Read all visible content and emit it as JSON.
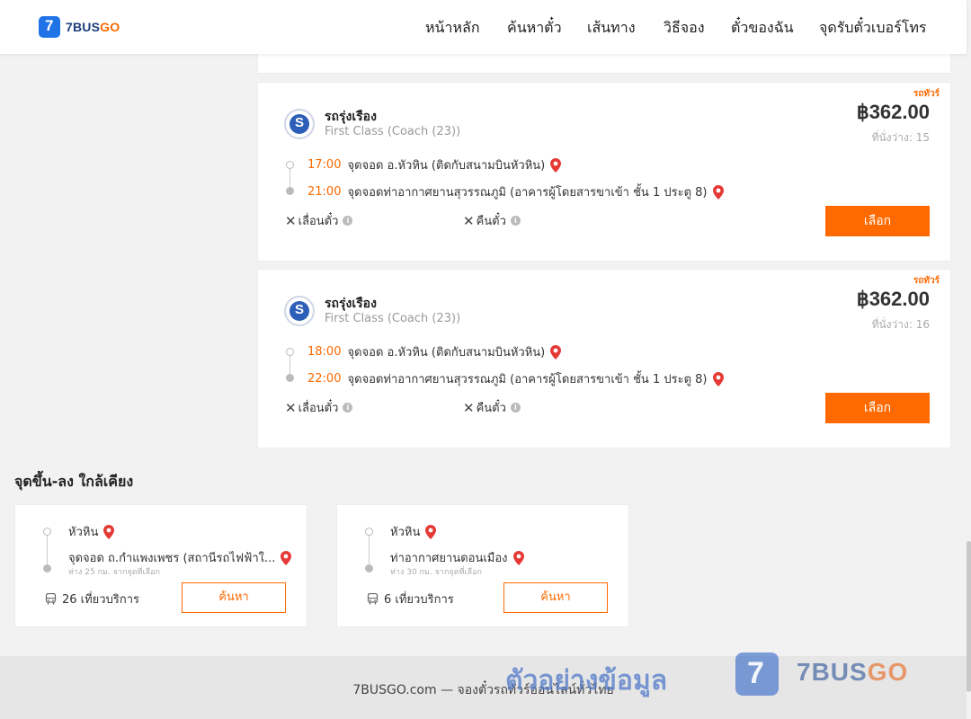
{
  "brand": {
    "logo_part1": "7BUS",
    "logo_part2": "GO"
  },
  "nav": [
    "หน้าหลัก",
    "ค้นหาตั๋ว",
    "เส้นทาง",
    "วิธีจอง",
    "ตั๋วของฉัน",
    "จุดรับตั๋วเบอร์โทร"
  ],
  "trips": [
    {
      "promo": "รถทัวร์",
      "operator": "รถรุ่งเรือง",
      "class": "First Class (Coach (23))",
      "price": "฿362.00",
      "seats": "ที่นั่งว่าง: 15",
      "depart_time": "17:00",
      "depart_stop": "จุดจอด อ.หัวหิน (ติดกับสนามบินหัวหิน)",
      "arrive_time": "21:00",
      "arrive_stop": "จุดจอดท่าอากาศยานสุวรรณภูมิ (อาคารผู้โดยสารขาเข้า ชั้น 1 ประตู 8)",
      "reschedule": "เลื่อนตั๋ว",
      "refund": "คืนตั๋ว",
      "select": "เลือก"
    },
    {
      "promo": "รถทัวร์",
      "operator": "รถรุ่งเรือง",
      "class": "First Class (Coach (23))",
      "price": "฿362.00",
      "seats": "ที่นั่งว่าง: 16",
      "depart_time": "18:00",
      "depart_stop": "จุดจอด อ.หัวหิน (ติดกับสนามบินหัวหิน)",
      "arrive_time": "22:00",
      "arrive_stop": "จุดจอดท่าอากาศยานสุวรรณภูมิ (อาคารผู้โดยสารขาเข้า ชั้น 1 ประตู 8)",
      "reschedule": "เลื่อนตั๋ว",
      "refund": "คืนตั๋ว",
      "select": "เลือก"
    }
  ],
  "nearby": {
    "title": "จุดขึ้น-ลง ใกล้เคียง",
    "items": [
      {
        "origin": "หัวหิน",
        "destination": "จุดจอด ถ.กำแพงเพชร (สถานีรถไฟฟ้าใ...",
        "distance": "ห่าง 25 กม. จากจุดที่เลือก",
        "trips": "26 เที่ยวบริการ",
        "button": "ค้นหา"
      },
      {
        "origin": "หัวหิน",
        "destination": "ท่าอากาศยานดอนเมือง",
        "distance": "ห่าง 30 กม. จากจุดที่เลือก",
        "trips": "6 เที่ยวบริการ",
        "button": "ค้นหา"
      }
    ]
  },
  "footer": {
    "text": "7BUSGO.com — จองตั๋วรถทัวร์ออนไลน์ทั่วไทย"
  },
  "watermark": {
    "text": "ตัวอย่างข้อมูล",
    "brand_part1": "7BUS",
    "brand_part2": "GO"
  },
  "colors": {
    "accent": "#ff6a00",
    "brand_blue": "#1f73e6",
    "pin_red": "#e53935"
  }
}
